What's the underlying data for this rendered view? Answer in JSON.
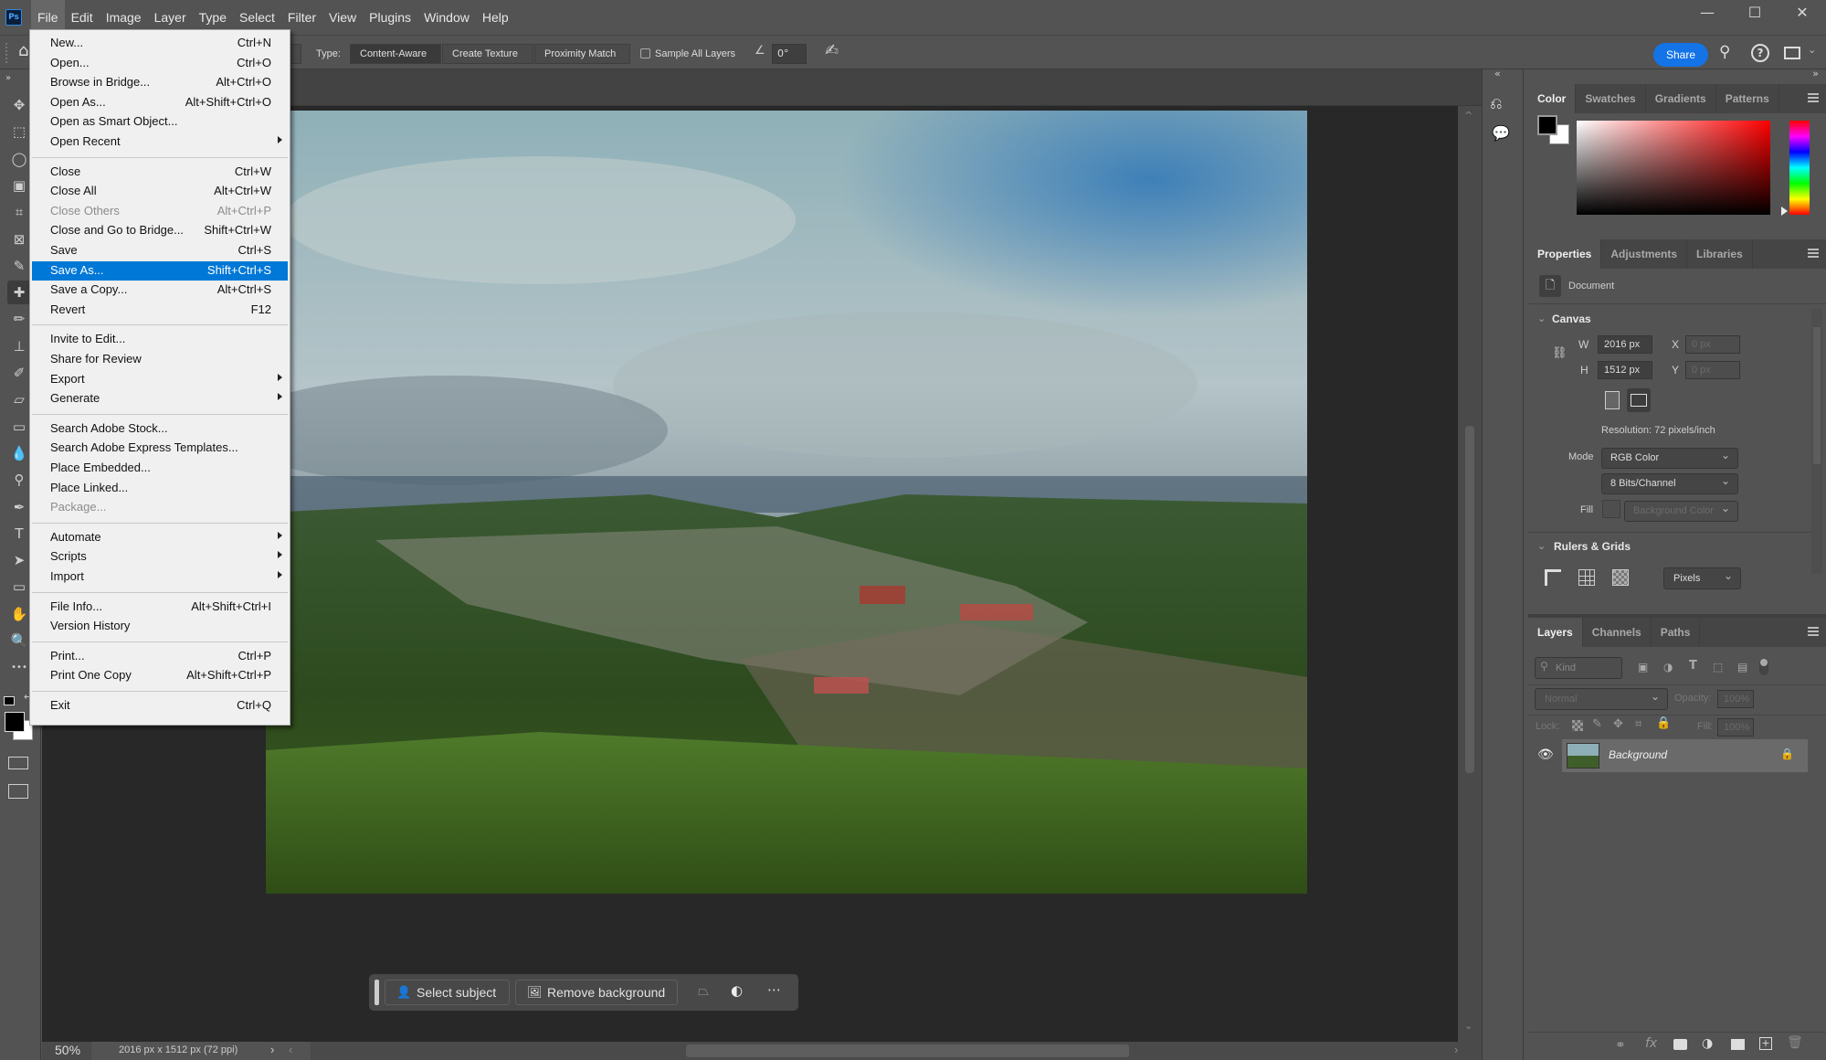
{
  "app": {
    "logo": "Ps"
  },
  "menubar": {
    "items": [
      "File",
      "Edit",
      "Image",
      "Layer",
      "Type",
      "Select",
      "Filter",
      "View",
      "Plugins",
      "Window",
      "Help"
    ],
    "active": "File"
  },
  "window_controls": {
    "minimize": "—",
    "maximize": "☐",
    "close": "✕"
  },
  "options_bar": {
    "type_label": "Type:",
    "type_options": [
      "Content-Aware",
      "Create Texture",
      "Proximity Match"
    ],
    "type_selected": "Content-Aware",
    "sample_all_layers": {
      "label": "Sample All Layers",
      "checked": false
    },
    "angle_value": "0°",
    "share_label": "Share"
  },
  "file_menu": {
    "groups": [
      [
        {
          "label": "New...",
          "shortcut": "Ctrl+N"
        },
        {
          "label": "Open...",
          "shortcut": "Ctrl+O"
        },
        {
          "label": "Browse in Bridge...",
          "shortcut": "Alt+Ctrl+O"
        },
        {
          "label": "Open As...",
          "shortcut": "Alt+Shift+Ctrl+O"
        },
        {
          "label": "Open as Smart Object...",
          "shortcut": ""
        },
        {
          "label": "Open Recent",
          "shortcut": "",
          "submenu": true
        }
      ],
      [
        {
          "label": "Close",
          "shortcut": "Ctrl+W"
        },
        {
          "label": "Close All",
          "shortcut": "Alt+Ctrl+W"
        },
        {
          "label": "Close Others",
          "shortcut": "Alt+Ctrl+P",
          "disabled": true
        },
        {
          "label": "Close and Go to Bridge...",
          "shortcut": "Shift+Ctrl+W"
        },
        {
          "label": "Save",
          "shortcut": "Ctrl+S"
        },
        {
          "label": "Save As...",
          "shortcut": "Shift+Ctrl+S",
          "highlighted": true
        },
        {
          "label": "Save a Copy...",
          "shortcut": "Alt+Ctrl+S"
        },
        {
          "label": "Revert",
          "shortcut": "F12"
        }
      ],
      [
        {
          "label": "Invite to Edit...",
          "shortcut": ""
        },
        {
          "label": "Share for Review",
          "shortcut": ""
        },
        {
          "label": "Export",
          "shortcut": "",
          "submenu": true
        },
        {
          "label": "Generate",
          "shortcut": "",
          "submenu": true
        }
      ],
      [
        {
          "label": "Search Adobe Stock...",
          "shortcut": ""
        },
        {
          "label": "Search Adobe Express Templates...",
          "shortcut": ""
        },
        {
          "label": "Place Embedded...",
          "shortcut": ""
        },
        {
          "label": "Place Linked...",
          "shortcut": ""
        },
        {
          "label": "Package...",
          "shortcut": "",
          "disabled": true
        }
      ],
      [
        {
          "label": "Automate",
          "shortcut": "",
          "submenu": true
        },
        {
          "label": "Scripts",
          "shortcut": "",
          "submenu": true
        },
        {
          "label": "Import",
          "shortcut": "",
          "submenu": true
        }
      ],
      [
        {
          "label": "File Info...",
          "shortcut": "Alt+Shift+Ctrl+I"
        },
        {
          "label": "Version History",
          "shortcut": ""
        }
      ],
      [
        {
          "label": "Print...",
          "shortcut": "Ctrl+P"
        },
        {
          "label": "Print One Copy",
          "shortcut": "Alt+Shift+Ctrl+P"
        }
      ],
      [
        {
          "label": "Exit",
          "shortcut": "Ctrl+Q"
        }
      ]
    ]
  },
  "tools": [
    {
      "name": "move-tool",
      "glyph": "✥"
    },
    {
      "name": "marquee-tool",
      "glyph": "⬚"
    },
    {
      "name": "lasso-tool",
      "glyph": "◯"
    },
    {
      "name": "object-selection-tool",
      "glyph": "▣"
    },
    {
      "name": "crop-tool",
      "glyph": "⌗"
    },
    {
      "name": "frame-tool",
      "glyph": "⊠"
    },
    {
      "name": "eyedropper-tool",
      "glyph": "✎"
    },
    {
      "name": "healing-brush-tool",
      "glyph": "✚",
      "active": true
    },
    {
      "name": "brush-tool",
      "glyph": "✏"
    },
    {
      "name": "clone-stamp-tool",
      "glyph": "⊥"
    },
    {
      "name": "history-brush-tool",
      "glyph": "✐"
    },
    {
      "name": "eraser-tool",
      "glyph": "▱"
    },
    {
      "name": "gradient-tool",
      "glyph": "▭"
    },
    {
      "name": "blur-tool",
      "glyph": "💧"
    },
    {
      "name": "dodge-tool",
      "glyph": "⚲"
    },
    {
      "name": "pen-tool",
      "glyph": "✒"
    },
    {
      "name": "type-tool",
      "glyph": "T"
    },
    {
      "name": "path-selection-tool",
      "glyph": "➤"
    },
    {
      "name": "rectangle-tool",
      "glyph": "▭"
    },
    {
      "name": "hand-tool",
      "glyph": "✋"
    },
    {
      "name": "zoom-tool",
      "glyph": "🔍"
    },
    {
      "name": "more-tools",
      "glyph": "•••"
    }
  ],
  "colors": {
    "foreground": "#000000",
    "background": "#ffffff",
    "accent": "#1473e6",
    "menu_highlight": "#0078d7"
  },
  "contextual_bar": {
    "select_subject": "Select subject",
    "remove_background": "Remove background"
  },
  "status_bar": {
    "zoom": "50%",
    "doc_info": "2016 px x 1512 px (72 ppi)"
  },
  "color_panel": {
    "tabs": [
      "Color",
      "Swatches",
      "Gradients",
      "Patterns"
    ],
    "active": "Color"
  },
  "properties_panel": {
    "tabs": [
      "Properties",
      "Adjustments",
      "Libraries"
    ],
    "active": "Properties",
    "kind": "Document",
    "canvas": {
      "title": "Canvas",
      "w_label": "W",
      "w_value": "2016 px",
      "h_label": "H",
      "h_value": "1512 px",
      "x_label": "X",
      "x_value": "0 px",
      "y_label": "Y",
      "y_value": "0 px",
      "resolution": "Resolution: 72 pixels/inch",
      "mode_label": "Mode",
      "mode_value": "RGB Color",
      "depth_value": "8 Bits/Channel",
      "fill_label": "Fill",
      "fill_value": "Background Color"
    },
    "rulers": {
      "title": "Rulers & Grids",
      "units": "Pixels"
    }
  },
  "layers_panel": {
    "tabs": [
      "Layers",
      "Channels",
      "Paths"
    ],
    "active": "Layers",
    "filter_placeholder": "Kind",
    "blend_mode": "Normal",
    "opacity_label": "Opacity:",
    "opacity_value": "100%",
    "lock_label": "Lock:",
    "fill_label": "Fill:",
    "fill_value": "100%",
    "layers": [
      {
        "name": "Background",
        "visible": true,
        "locked": true
      }
    ]
  }
}
